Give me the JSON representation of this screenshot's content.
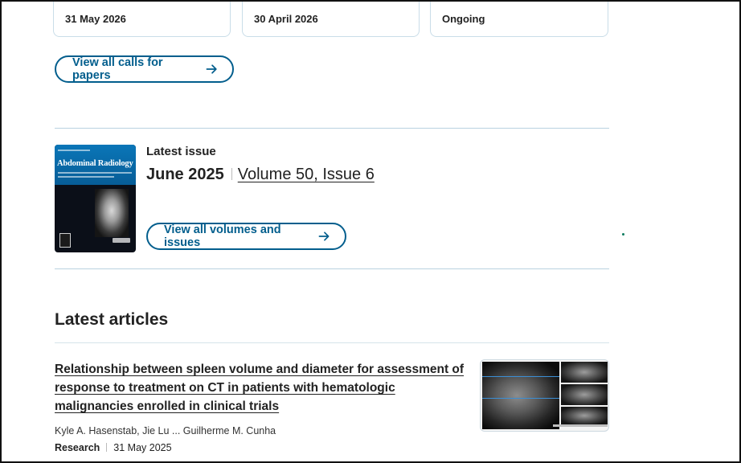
{
  "calls_cards": [
    {
      "date": "31 May 2026"
    },
    {
      "date": "30 April 2026"
    },
    {
      "date": "Ongoing"
    }
  ],
  "calls": {
    "view_all_label": "View all calls for papers"
  },
  "latest_issue": {
    "label": "Latest issue",
    "month": "June 2025",
    "volume_issue": "Volume 50, Issue 6",
    "view_all_label": "View all volumes and issues",
    "cover_title": "Abdominal Radiology"
  },
  "latest_articles": {
    "heading": "Latest articles",
    "items": [
      {
        "title": "Relationship between spleen volume and diameter for assessment of response to treatment on CT in patients with hematologic malignancies enrolled in clinical trials",
        "authors": "Kyle A. Hasenstab, Jie Lu ... Guilherme M. Cunha",
        "type": "Research",
        "date": "31 May 2025"
      }
    ]
  },
  "icons": {
    "arrow": "arrow-right-icon"
  },
  "colors": {
    "accent": "#025e8d",
    "divider": "#b9d2e0"
  }
}
